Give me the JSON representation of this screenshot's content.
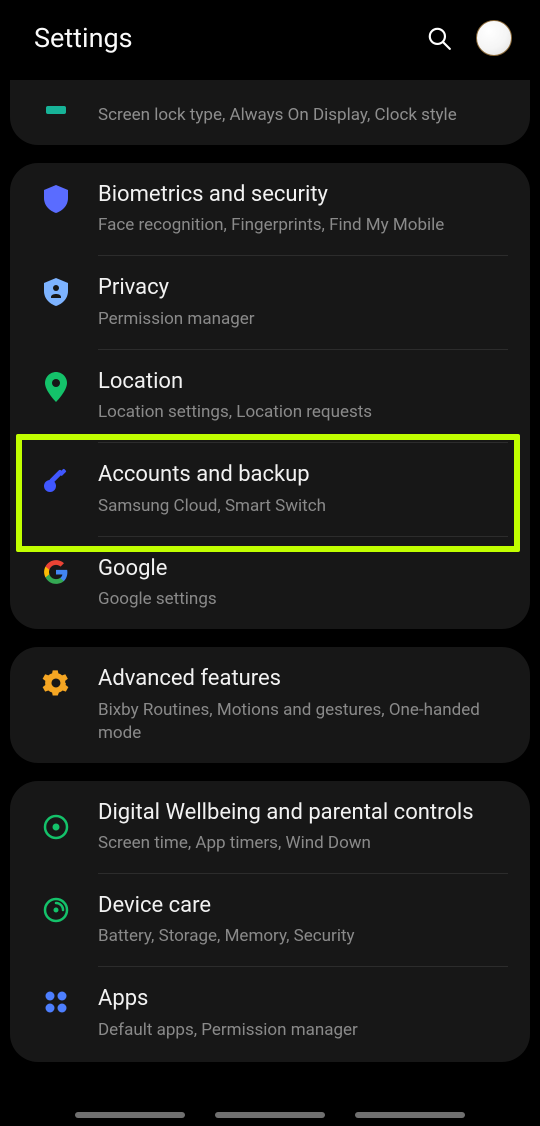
{
  "header": {
    "title": "Settings"
  },
  "groups": [
    {
      "items": [
        {
          "icon": "partial",
          "subtitle": "Screen lock type, Always On Display, Clock style"
        }
      ]
    },
    {
      "items": [
        {
          "icon": "shield",
          "title": "Biometrics and security",
          "subtitle": "Face recognition, Fingerprints, Find My Mobile"
        },
        {
          "icon": "privacy",
          "title": "Privacy",
          "subtitle": "Permission manager"
        },
        {
          "icon": "location",
          "title": "Location",
          "subtitle": "Location settings, Location requests"
        },
        {
          "icon": "key",
          "title": "Accounts and backup",
          "subtitle": "Samsung Cloud, Smart Switch",
          "highlighted": true
        },
        {
          "icon": "google",
          "title": "Google",
          "subtitle": "Google settings"
        }
      ]
    },
    {
      "items": [
        {
          "icon": "gear",
          "title": "Advanced features",
          "subtitle": "Bixby Routines, Motions and gestures, One-handed mode"
        }
      ]
    },
    {
      "items": [
        {
          "icon": "wellbeing",
          "title": "Digital Wellbeing and parental controls",
          "subtitle": "Screen time, App timers, Wind Down"
        },
        {
          "icon": "device",
          "title": "Device care",
          "subtitle": "Battery, Storage, Memory, Security"
        },
        {
          "icon": "apps",
          "title": "Apps",
          "subtitle": "Default apps, Permission manager"
        }
      ]
    }
  ]
}
